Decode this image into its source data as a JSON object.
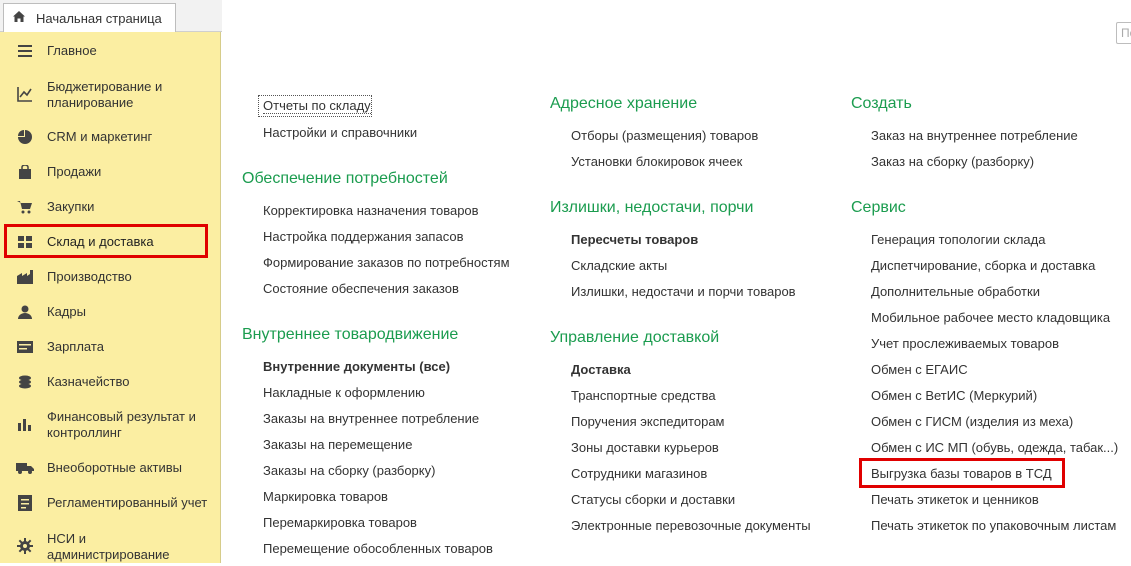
{
  "tab": {
    "home_label": "Начальная страница"
  },
  "search": {
    "placeholder": "По"
  },
  "colors": {
    "accent_green": "#1b9c4f",
    "sidebar_bg": "#fbeea2",
    "highlight_red": "#e00000"
  },
  "sidebar": {
    "items": [
      {
        "label": "Главное",
        "icon": "menu-lines-icon"
      },
      {
        "label": "Бюджетирование и планирование",
        "icon": "budget-chart-icon"
      },
      {
        "label": "CRM и маркетинг",
        "icon": "pie-chart-icon"
      },
      {
        "label": "Продажи",
        "icon": "shopping-bag-icon"
      },
      {
        "label": "Закупки",
        "icon": "cart-icon"
      },
      {
        "label": "Склад и доставка",
        "icon": "warehouse-grid-icon",
        "active": true
      },
      {
        "label": "Производство",
        "icon": "factory-icon"
      },
      {
        "label": "Кадры",
        "icon": "person-icon"
      },
      {
        "label": "Зарплата",
        "icon": "wallet-icon"
      },
      {
        "label": "Казначейство",
        "icon": "coins-icon"
      },
      {
        "label": "Финансовый результат и контроллинг",
        "icon": "bar-chart-icon"
      },
      {
        "label": "Внеоборотные активы",
        "icon": "truck-icon"
      },
      {
        "label": "Регламентированный учет",
        "icon": "document-icon"
      },
      {
        "label": "НСИ и администрирование",
        "icon": "gear-icon"
      }
    ]
  },
  "columns": {
    "col1": {
      "top_links": [
        "Отчеты по складу",
        "Настройки и справочники"
      ],
      "sections": [
        {
          "title": "Обеспечение потребностей",
          "links": [
            "Корректировка назначения товаров",
            "Настройка поддержания запасов",
            "Формирование заказов по потребностям",
            "Состояние обеспечения заказов"
          ]
        },
        {
          "title": "Внутреннее товародвижение",
          "links": [
            "Внутренние документы (все)",
            "Накладные к оформлению",
            "Заказы на внутреннее потребление",
            "Заказы на перемещение",
            "Заказы на сборку (разборку)",
            "Маркировка товаров",
            "Перемаркировка товаров",
            "Перемещение обособленных товаров"
          ]
        }
      ]
    },
    "col2": {
      "sections": [
        {
          "title": "Адресное хранение",
          "links": [
            "Отборы (размещения) товаров",
            "Установки блокировок ячеек"
          ]
        },
        {
          "title": "Излишки, недостачи, порчи",
          "links": [
            "Пересчеты товаров",
            "Складские акты",
            "Излишки, недостачи и порчи товаров"
          ]
        },
        {
          "title": "Управление доставкой",
          "links": [
            "Доставка",
            "Транспортные средства",
            "Поручения экспедиторам",
            "Зоны доставки курьеров",
            "Сотрудники магазинов",
            "Статусы сборки и доставки",
            "Электронные перевозочные документы"
          ]
        }
      ]
    },
    "col3": {
      "sections": [
        {
          "title": "Создать",
          "links": [
            "Заказ на внутреннее потребление",
            "Заказ на сборку (разборку)"
          ]
        },
        {
          "title": "Сервис",
          "links": [
            "Генерация топологии склада",
            "Диспетчирование, сборка и доставка",
            "Дополнительные обработки",
            "Мобильное рабочее место кладовщика",
            "Учет прослеживаемых товаров",
            "Обмен с ЕГАИС",
            "Обмен с ВетИС (Меркурий)",
            "Обмен с ГИСМ (изделия из меха)",
            "Обмен с ИС МП (обувь, одежда, табак...)",
            "Выгрузка базы товаров в ТСД",
            "Печать этикеток и ценников",
            "Печать этикеток по упаковочным листам"
          ]
        }
      ]
    }
  }
}
